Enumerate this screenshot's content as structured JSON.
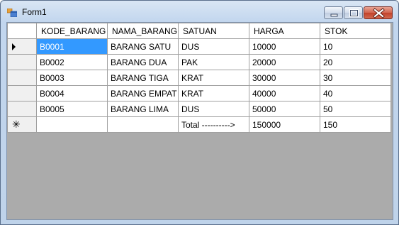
{
  "window": {
    "title": "Form1"
  },
  "grid": {
    "columns": [
      "KODE_BARANG",
      "NAMA_BARANG",
      "SATUAN",
      "HARGA",
      "STOK"
    ],
    "rows": [
      [
        "B0001",
        "BARANG SATU",
        "DUS",
        "10000",
        "10"
      ],
      [
        "B0002",
        "BARANG DUA",
        "PAK",
        "20000",
        "20"
      ],
      [
        "B0003",
        "BARANG TIGA",
        "KRAT",
        "30000",
        "30"
      ],
      [
        "B0004",
        "BARANG EMPAT",
        "KRAT",
        "40000",
        "40"
      ],
      [
        "B0005",
        "BARANG LIMA",
        "DUS",
        "50000",
        "50"
      ]
    ],
    "new_row": [
      "",
      "",
      "Total ---------->",
      "150000",
      "150"
    ],
    "selected_cell": "B0001"
  },
  "icons": {
    "current_row": "row-pointer-icon",
    "new_row": "new-row-asterisk-icon"
  }
}
